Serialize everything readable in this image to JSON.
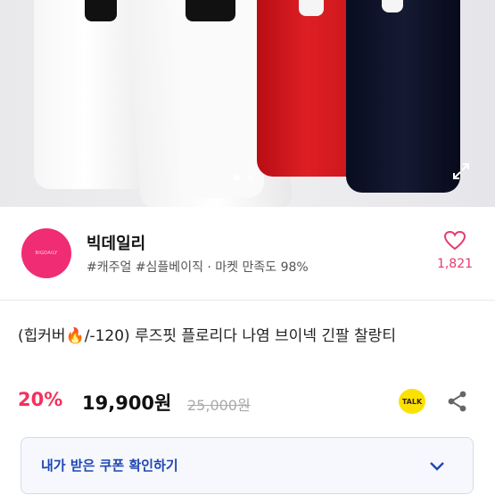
{
  "seller": {
    "avatar_text": "BIGDAILY",
    "name": "빅데일리",
    "tags": "#캐주얼 #심플베이직 · 마켓 만족도 98%",
    "likes": "1,821"
  },
  "product": {
    "title": "(힙커버🔥/-120) 루즈핏 플로리다 나염 브이넥 긴팔 찰랑티",
    "discount": "20%",
    "price": "19,900원",
    "original_price": "25,000원",
    "talk_label": "TALK"
  },
  "coupon": {
    "label": "내가 받은 쿠폰 확인하기"
  },
  "gallery": {
    "page_count": 2,
    "active_index": 0
  },
  "colors": {
    "accent_pink": "#f5305e",
    "coupon_text": "#1f46b3",
    "kakao_yellow": "#fae100"
  },
  "icons": [
    "expand-icon",
    "heart-icon",
    "share-icon",
    "chevron-down-icon"
  ]
}
